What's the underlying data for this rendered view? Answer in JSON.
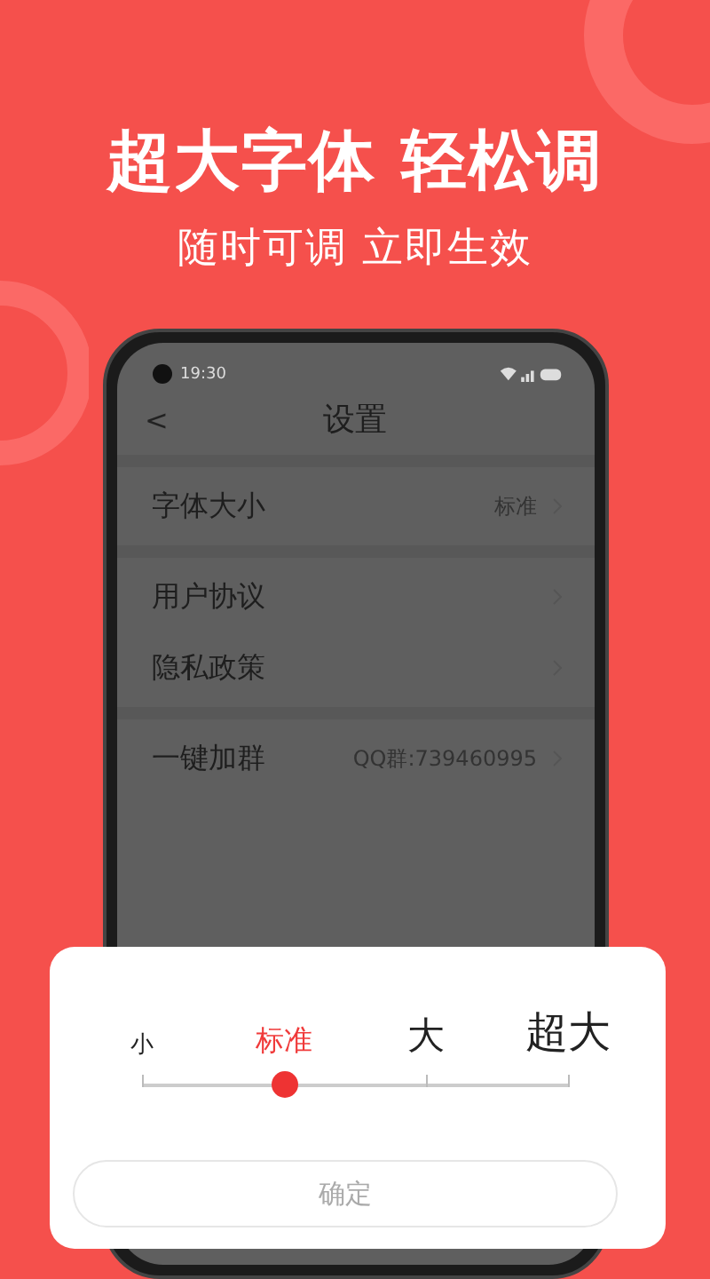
{
  "headline": "超大字体 轻松调",
  "subheadline": "随时可调 立即生效",
  "phone": {
    "status_bar": {
      "time": "19:30"
    },
    "header": {
      "back": "<",
      "title": "设置"
    },
    "groups": [
      [
        {
          "label": "字体大小",
          "value": "标准"
        }
      ],
      [
        {
          "label": "用户协议"
        },
        {
          "label": "隐私政策"
        }
      ],
      [
        {
          "label": "一键加群",
          "value": "QQ群:739460995"
        }
      ]
    ]
  },
  "font_dialog": {
    "options": [
      {
        "label": "小",
        "selected": false
      },
      {
        "label": "标准",
        "selected": true
      },
      {
        "label": "大",
        "selected": false
      },
      {
        "label": "超大",
        "selected": false
      }
    ],
    "slider": {
      "level": 0.333
    },
    "confirm": "确定"
  }
}
